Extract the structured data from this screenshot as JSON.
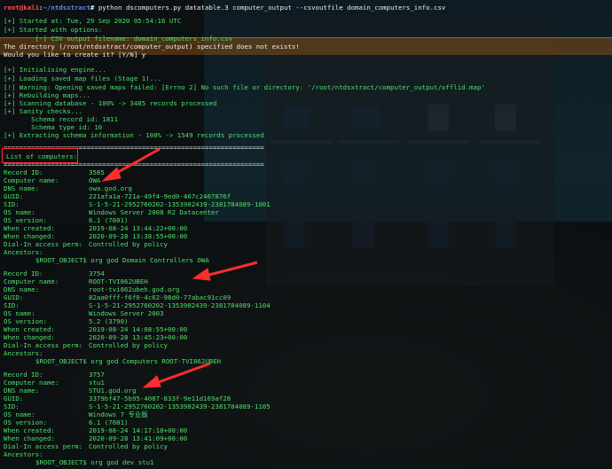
{
  "prompt": {
    "user": "root@kali",
    "path": "~/ntdsxtract",
    "symbol": "#",
    "command": "python dscomputers.py datatable.3 computer_output --csvoutfile domain_computers_info.csv"
  },
  "header_lines": [
    "[+] Started at: Tue, 29 Sep 2020 05:54:16 UTC",
    "[+] Started with options:",
    "        [-] CSV output filename: domain_computers_info.csv",
    "The directory (/root/ntdsxtract/computer_output) specified does not exists!",
    "Would you like to create it? [Y/N] y"
  ],
  "engine_lines": [
    "[+] Initialising engine...",
    "[+] Loading saved map files (Stage 1)...",
    "[!] Warning: Opening saved maps failed: [Errno 2] No such file or directory: '/root/ntdsxtract/computer_output/offlid.map'",
    "[+] Rebuilding maps...",
    "[+] Scanning database - 100% -> 3485 records processed",
    "[+] Sanity checks...",
    "       Schema record id: 1811",
    "       Schema type id: 10",
    "[+] Extracting schema information - 100% -> 1549 records processed"
  ],
  "separator": "==================================================================",
  "list_title": "List of computers:",
  "computers": [
    {
      "record_id": "3585",
      "name": "OWA",
      "dns": "owa.god.org",
      "guid": "221afa1a-721a-49f4-9ed0-467c2467876f",
      "sid": "S-1-5-21-2952760202-1353902439-2381784089-1001",
      "os_name": "Windows Server 2008 R2 Datacenter",
      "os_version": "6.1 (7601)",
      "created": "2019-08-24 13:44:22+00:00",
      "changed": "2020-09-28 13:38:55+00:00",
      "dialin": "Controlled by policy",
      "ancestors": "$ROOT_OBJECT$ org god Domain Controllers OWA"
    },
    {
      "record_id": "3754",
      "name": "ROOT-TVI862UBEH",
      "dns": "root-tvi862ubeh.god.org",
      "guid": "82aa0fff-f6f0-4c62-98d0-77abac91cc09",
      "sid": "S-1-5-21-2952760202-1353902439-2381784089-1104",
      "os_name": "Windows Server 2003",
      "os_version": "5.2 (3790)",
      "created": "2019-08-24 14:08:55+00:00",
      "changed": "2020-09-28 13:45:23+00:00",
      "dialin": "Controlled by policy",
      "ancestors": "$ROOT_OBJECT$ org god Computers ROOT-TVI862UBEH"
    },
    {
      "record_id": "3757",
      "name": "stu1",
      "dns": "STU1.god.org",
      "guid": "3379bf47-5b95-4087-833f-9e11d169af28",
      "sid": "S-1-5-21-2952760202-1353902439-2381784089-1105",
      "os_name": "Windows 7 专业版",
      "os_version": "6.1 (7601)",
      "created": "2019-08-24 14:17:18+00:00",
      "changed": "2020-09-28 13:41:09+00:00",
      "dialin": "Controlled by policy",
      "ancestors": "$ROOT_OBJECT$ org god dev stu1"
    }
  ],
  "field_labels": {
    "record_id": "Record ID:",
    "name": "Computer name:",
    "dns": "DNS name:",
    "guid": "GUID:",
    "sid": "SID:",
    "os_name": "OS name:",
    "os_version": "OS version:",
    "created": "When created:",
    "changed": "When changed:",
    "dialin": "Dial-In access perm:",
    "ancestors": "Ancestors:"
  },
  "colors": {
    "prompt_user": "#ff4e4e",
    "prompt_path": "#4f8cff",
    "status_text": "#4de067",
    "annotation": "#ff2d2d",
    "warning_band": "#c46e14"
  },
  "annotations": {
    "box_target": "list-of-computers-title",
    "arrow_targets": [
      "computer-name-OWA",
      "computer-name-ROOT-TVI862UBEH",
      "dns-name-STU1.god.org"
    ]
  }
}
